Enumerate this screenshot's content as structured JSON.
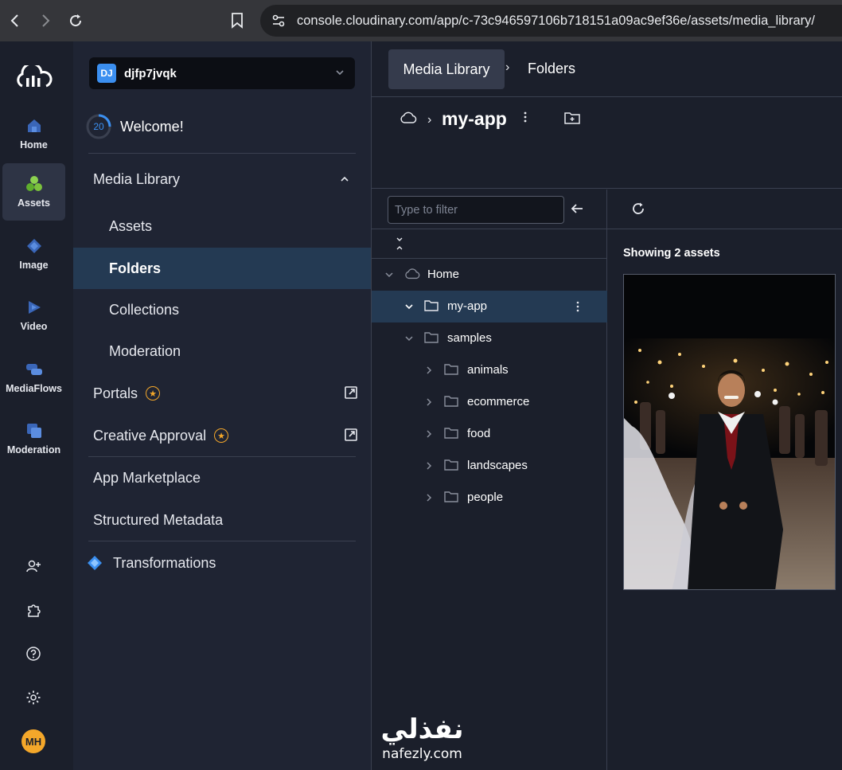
{
  "browser": {
    "url": "console.cloudinary.com/app/c-73c946597106b718151a09ac9ef36e/assets/media_library/"
  },
  "rail": {
    "items": [
      {
        "label": "Home",
        "icon": "home-icon"
      },
      {
        "label": "Assets",
        "icon": "assets-icon",
        "active": true
      },
      {
        "label": "Image",
        "icon": "image-icon"
      },
      {
        "label": "Video",
        "icon": "video-icon"
      },
      {
        "label": "MediaFlows",
        "icon": "mediaflows-icon"
      },
      {
        "label": "Moderation",
        "icon": "moderation-icon"
      }
    ],
    "avatar": "MH"
  },
  "sidenav": {
    "cloud_badge": "DJ",
    "cloud_name": "djfp7jvqk",
    "progress": "20",
    "welcome": "Welcome!",
    "media_library": "Media Library",
    "assets": "Assets",
    "folders": "Folders",
    "collections": "Collections",
    "moderation": "Moderation",
    "portals": "Portals",
    "creative_approval": "Creative Approval",
    "app_marketplace": "App Marketplace",
    "structured_metadata": "Structured Metadata",
    "transformations": "Transformations"
  },
  "main": {
    "breadcrumb_root": "Media Library",
    "breadcrumb_current": "Folders",
    "folder_name": "my-app",
    "filter_placeholder": "Type to filter",
    "showing": "Showing 2 assets"
  },
  "tree": {
    "home": "Home",
    "my_app": "my-app",
    "samples": "samples",
    "children": [
      "animals",
      "ecommerce",
      "food",
      "landscapes",
      "people"
    ]
  },
  "watermark": {
    "arabic": "نفذلي",
    "latin": "nafezly.com"
  },
  "colors": {
    "accent": "#3b8ff0",
    "selected_bg": "#243a53",
    "star": "#f4a72a"
  }
}
